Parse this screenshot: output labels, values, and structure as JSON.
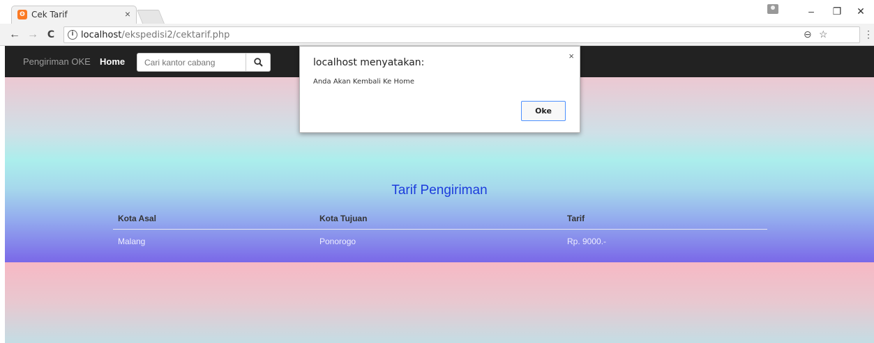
{
  "browser": {
    "tab_title": "Cek Tarif",
    "tab_close": "×",
    "favicon_glyph": "ʘ",
    "url_host": "localhost",
    "url_path": "/ekspedisi2/cektarif.php",
    "window_controls": {
      "minimize": "–",
      "restore": "❐",
      "close": "✕"
    },
    "nav": {
      "back": "←",
      "forward": "→",
      "reload": "C"
    },
    "omnibox_icons": {
      "zoom": "⊖",
      "star": "☆",
      "menu": "⋮"
    }
  },
  "navbar": {
    "brand": "Pengiriman OKE",
    "home": "Home",
    "search_placeholder": "Cari kantor cabang",
    "search_icon": "search-icon"
  },
  "main": {
    "title": "Tarif Pengiriman",
    "table": {
      "headers": [
        "Kota Asal",
        "Kota Tujuan",
        "Tarif"
      ],
      "rows": [
        [
          "Malang",
          "Ponorogo",
          "Rp. 9000.-"
        ]
      ]
    }
  },
  "dialog": {
    "title": "localhost menyatakan:",
    "message": "Anda Akan Kembali Ke Home",
    "ok_label": "Oke",
    "close": "×"
  },
  "colors": {
    "navbar_bg": "#222222",
    "hero_title": "#1c3cdc",
    "ok_border": "#4d90fe"
  }
}
